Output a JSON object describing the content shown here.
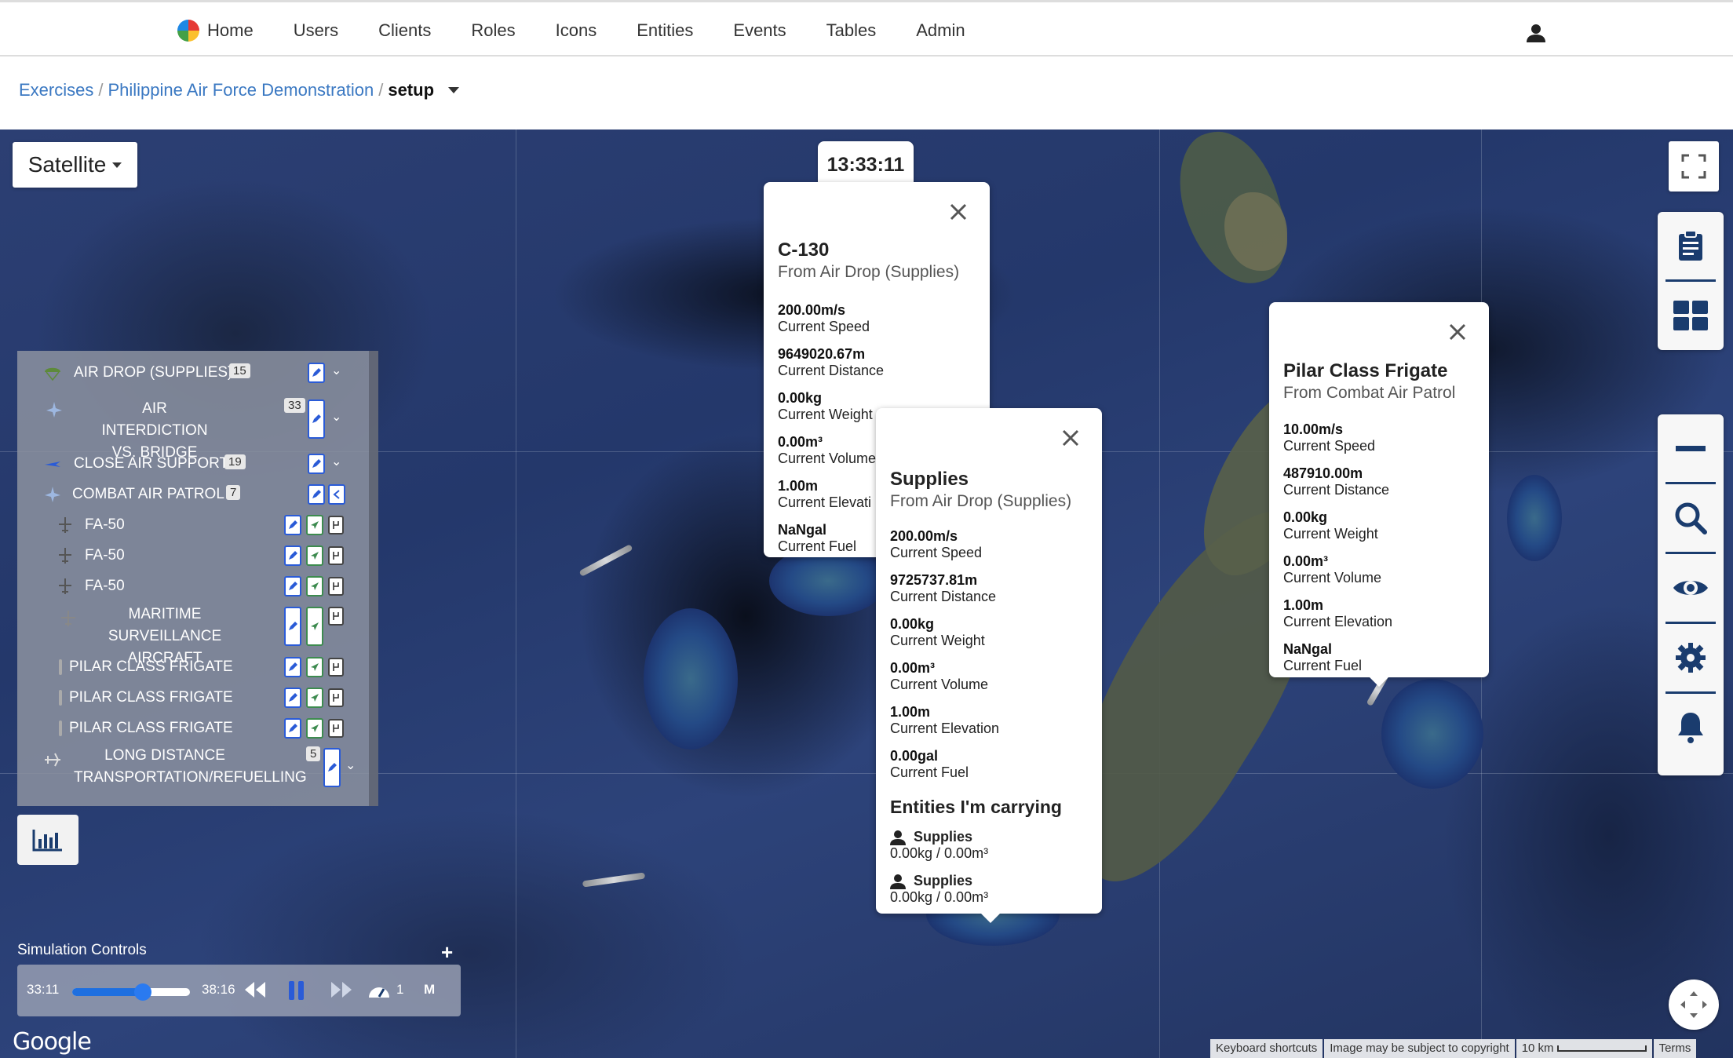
{
  "nav": {
    "items": [
      {
        "label": "Home",
        "icon": "home-logo"
      },
      {
        "label": "Users"
      },
      {
        "label": "Clients"
      },
      {
        "label": "Roles"
      },
      {
        "label": "Icons"
      },
      {
        "label": "Entities"
      },
      {
        "label": "Events"
      },
      {
        "label": "Tables"
      },
      {
        "label": "Admin"
      }
    ],
    "user_icon": "user-icon"
  },
  "breadcrumb": {
    "items": [
      "Exercises",
      "Philippine Air Force Demonstration"
    ],
    "current": "setup"
  },
  "map": {
    "type_label": "Satellite",
    "clock": "13:33:11"
  },
  "popups": {
    "c130": {
      "title": "C-130",
      "subtitle": "From Air Drop (Supplies)",
      "stats": [
        {
          "value": "200.00m/s",
          "label": "Current Speed"
        },
        {
          "value": "9649020.67m",
          "label": "Current Distance"
        },
        {
          "value": "0.00kg",
          "label": "Current Weight"
        },
        {
          "value": "0.00m³",
          "label": "Current Volume"
        },
        {
          "value": "1.00m",
          "label": "Current Elevati"
        },
        {
          "value": "NaNgal",
          "label": "Current Fuel"
        }
      ]
    },
    "supplies": {
      "title": "Supplies",
      "subtitle": "From Air Drop (Supplies)",
      "stats": [
        {
          "value": "200.00m/s",
          "label": "Current Speed"
        },
        {
          "value": "9725737.81m",
          "label": "Current Distance"
        },
        {
          "value": "0.00kg",
          "label": "Current Weight"
        },
        {
          "value": "0.00m³",
          "label": "Current Volume"
        },
        {
          "value": "1.00m",
          "label": "Current Elevation"
        },
        {
          "value": "0.00gal",
          "label": "Current Fuel"
        }
      ],
      "carrying_title": "Entities I'm carrying",
      "carrying": [
        {
          "name": "Supplies",
          "value": "0.00kg / 0.00m³"
        },
        {
          "name": "Supplies",
          "value": "0.00kg / 0.00m³"
        }
      ]
    },
    "frigate": {
      "title": "Pilar Class Frigate",
      "subtitle": "From Combat Air Patrol",
      "stats": [
        {
          "value": "10.00m/s",
          "label": "Current Speed"
        },
        {
          "value": "487910.00m",
          "label": "Current Distance"
        },
        {
          "value": "0.00kg",
          "label": "Current Weight"
        },
        {
          "value": "0.00m³",
          "label": "Current Volume"
        },
        {
          "value": "1.00m",
          "label": "Current Elevation"
        },
        {
          "value": "NaNgal",
          "label": "Current Fuel"
        }
      ]
    }
  },
  "layers": {
    "groups": [
      {
        "label": "AIR DROP (SUPPLIES)",
        "count": "15"
      },
      {
        "label": "AIR INTERDICTION VS. BRIDGE",
        "count": "33"
      },
      {
        "label": "CLOSE AIR SUPPORT",
        "count": "19"
      },
      {
        "label": "COMBAT AIR PATROL",
        "count": "7"
      },
      {
        "label": "LONG DISTANCE TRANSPORTATION/REFUELLING",
        "count": "5"
      }
    ],
    "entities": [
      "FA-50",
      "FA-50",
      "FA-50",
      "MARITIME SURVEILLANCE AIRCRAFT",
      "PILAR CLASS FRIGATE",
      "PILAR CLASS FRIGATE",
      "PILAR CLASS FRIGATE"
    ]
  },
  "sim": {
    "title": "Simulation Controls",
    "current_time": "33:11",
    "end_time": "38:16",
    "progress": 0.6,
    "speed": "1",
    "mode": "M"
  },
  "footer": {
    "google": "Google",
    "shortcuts": "Keyboard shortcuts",
    "copyright": "Image may be subject to copyright",
    "scale": "10 km",
    "terms": "Terms"
  },
  "colors": {
    "link": "#3a78c2",
    "accent": "#2a5bd7",
    "rail_divider": "#1a3c6e"
  }
}
